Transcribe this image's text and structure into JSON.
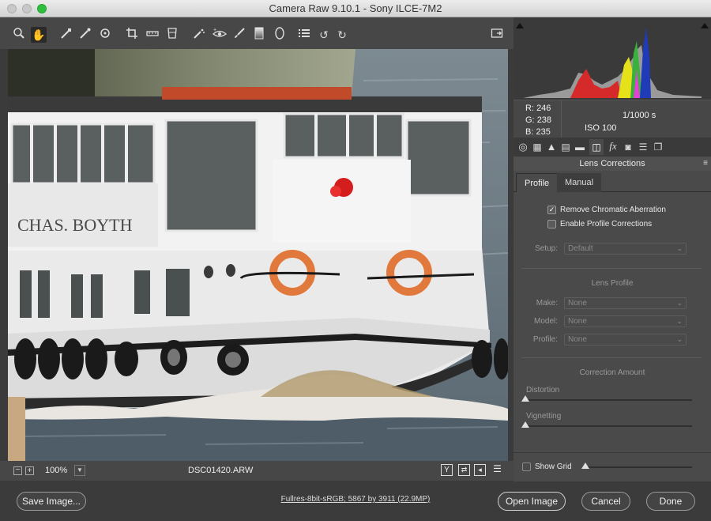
{
  "window": {
    "title": "Camera Raw 9.10.1  -  Sony ILCE-7M2"
  },
  "colors": {
    "chrome": "#474747",
    "panel": "#4a4a4a",
    "histogram_bg": "#3a3a3a",
    "histogram_blue": "#1f3bb8",
    "histogram_yellow": "#e6e21a",
    "histogram_red": "#d62a2a",
    "histogram_green": "#38b23a"
  },
  "toolbar": {
    "icons": [
      "zoom-icon",
      "hand-icon",
      "white-balance-icon",
      "color-sampler-icon",
      "targeted-adjustment-icon",
      "crop-icon",
      "straighten-icon",
      "transform-icon",
      "spot-removal-icon",
      "red-eye-icon",
      "adjustment-brush-icon",
      "graduated-filter-icon",
      "radial-filter-icon",
      "preferences-icon",
      "rotate-left-icon",
      "rotate-right-icon"
    ],
    "fullscreen_icon": "full-screen-icon"
  },
  "view": {
    "zoom": "100%",
    "filename": "DSC01420.ARW",
    "image_text": "CHAS. BOYTH"
  },
  "readout": {
    "r_label": "R:",
    "r_value": "246",
    "g_label": "G:",
    "g_value": "238",
    "b_label": "B:",
    "b_value": "235",
    "shutter": "1/1000 s",
    "iso": "ISO 100"
  },
  "panel": {
    "title": "Lens Corrections",
    "tabs": [
      {
        "label": "Profile"
      },
      {
        "label": "Manual"
      }
    ],
    "remove_ca": {
      "label": "Remove Chromatic Aberration",
      "checked": true
    },
    "enable_profile": {
      "label": "Enable Profile Corrections",
      "checked": false
    },
    "setup": {
      "label": "Setup:",
      "value": "Default"
    },
    "lens_profile_title": "Lens Profile",
    "make": {
      "label": "Make:",
      "value": "None"
    },
    "model": {
      "label": "Model:",
      "value": "None"
    },
    "profile": {
      "label": "Profile:",
      "value": "None"
    },
    "correction_amount_title": "Correction Amount",
    "distortion": {
      "label": "Distortion"
    },
    "vignetting": {
      "label": "Vignetting"
    },
    "show_grid": {
      "label": "Show Grid",
      "checked": false
    }
  },
  "footer": {
    "save_label": "Save Image...",
    "workflow": "Fullres-8bit-sRGB; 5867 by 3911 (22.9MP)",
    "open_label": "Open Image",
    "cancel_label": "Cancel",
    "done_label": "Done"
  }
}
